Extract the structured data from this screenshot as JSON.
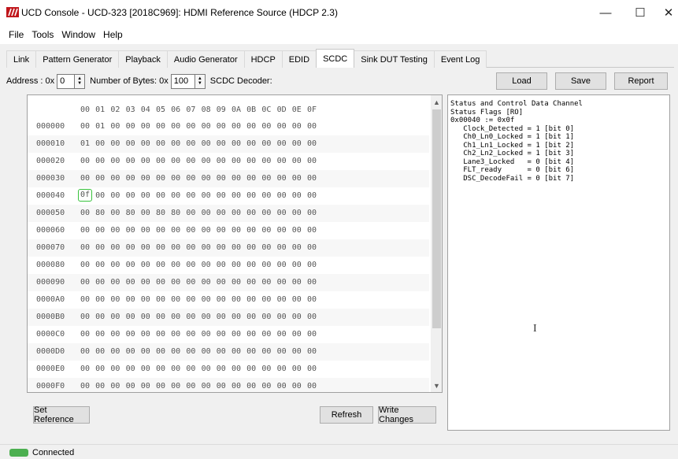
{
  "window": {
    "title": "UCD Console - UCD-323 [2018C969]: HDMI Reference Source (HDCP 2.3)",
    "minimize": "—",
    "maximize": "☐",
    "close": "✕"
  },
  "menu": [
    "File",
    "Tools",
    "Window",
    "Help"
  ],
  "tabs": [
    {
      "label": "Link"
    },
    {
      "label": "Pattern Generator"
    },
    {
      "label": "Playback"
    },
    {
      "label": "Audio Generator"
    },
    {
      "label": "HDCP"
    },
    {
      "label": "EDID"
    },
    {
      "label": "SCDC",
      "active": true
    },
    {
      "label": "Sink DUT Testing"
    },
    {
      "label": "Event Log"
    }
  ],
  "toolbar": {
    "address_label": "Address : 0x",
    "address_value": "0",
    "bytes_label": "Number of Bytes: 0x",
    "bytes_value": "100",
    "decoder_label": "SCDC Decoder:",
    "load": "Load",
    "save": "Save",
    "report": "Report"
  },
  "hex": {
    "columns": [
      "00",
      "01",
      "02",
      "03",
      "04",
      "05",
      "06",
      "07",
      "08",
      "09",
      "0A",
      "0B",
      "0C",
      "0D",
      "0E",
      "0F"
    ],
    "selected": {
      "row": 4,
      "col": 0
    },
    "rows": [
      {
        "addr": "000000",
        "bytes": [
          "00",
          "01",
          "00",
          "00",
          "00",
          "00",
          "00",
          "00",
          "00",
          "00",
          "00",
          "00",
          "00",
          "00",
          "00",
          "00"
        ]
      },
      {
        "addr": "000010",
        "bytes": [
          "01",
          "00",
          "00",
          "00",
          "00",
          "00",
          "00",
          "00",
          "00",
          "00",
          "00",
          "00",
          "00",
          "00",
          "00",
          "00"
        ]
      },
      {
        "addr": "000020",
        "bytes": [
          "00",
          "00",
          "00",
          "00",
          "00",
          "00",
          "00",
          "00",
          "00",
          "00",
          "00",
          "00",
          "00",
          "00",
          "00",
          "00"
        ]
      },
      {
        "addr": "000030",
        "bytes": [
          "00",
          "00",
          "00",
          "00",
          "00",
          "00",
          "00",
          "00",
          "00",
          "00",
          "00",
          "00",
          "00",
          "00",
          "00",
          "00"
        ]
      },
      {
        "addr": "000040",
        "bytes": [
          "0f",
          "00",
          "00",
          "00",
          "00",
          "00",
          "00",
          "00",
          "00",
          "00",
          "00",
          "00",
          "00",
          "00",
          "00",
          "00"
        ]
      },
      {
        "addr": "000050",
        "bytes": [
          "00",
          "80",
          "00",
          "80",
          "00",
          "80",
          "80",
          "00",
          "00",
          "00",
          "00",
          "00",
          "00",
          "00",
          "00",
          "00"
        ]
      },
      {
        "addr": "000060",
        "bytes": [
          "00",
          "00",
          "00",
          "00",
          "00",
          "00",
          "00",
          "00",
          "00",
          "00",
          "00",
          "00",
          "00",
          "00",
          "00",
          "00"
        ]
      },
      {
        "addr": "000070",
        "bytes": [
          "00",
          "00",
          "00",
          "00",
          "00",
          "00",
          "00",
          "00",
          "00",
          "00",
          "00",
          "00",
          "00",
          "00",
          "00",
          "00"
        ]
      },
      {
        "addr": "000080",
        "bytes": [
          "00",
          "00",
          "00",
          "00",
          "00",
          "00",
          "00",
          "00",
          "00",
          "00",
          "00",
          "00",
          "00",
          "00",
          "00",
          "00"
        ]
      },
      {
        "addr": "000090",
        "bytes": [
          "00",
          "00",
          "00",
          "00",
          "00",
          "00",
          "00",
          "00",
          "00",
          "00",
          "00",
          "00",
          "00",
          "00",
          "00",
          "00"
        ]
      },
      {
        "addr": "0000A0",
        "bytes": [
          "00",
          "00",
          "00",
          "00",
          "00",
          "00",
          "00",
          "00",
          "00",
          "00",
          "00",
          "00",
          "00",
          "00",
          "00",
          "00"
        ]
      },
      {
        "addr": "0000B0",
        "bytes": [
          "00",
          "00",
          "00",
          "00",
          "00",
          "00",
          "00",
          "00",
          "00",
          "00",
          "00",
          "00",
          "00",
          "00",
          "00",
          "00"
        ]
      },
      {
        "addr": "0000C0",
        "bytes": [
          "00",
          "00",
          "00",
          "00",
          "00",
          "00",
          "00",
          "00",
          "00",
          "00",
          "00",
          "00",
          "00",
          "00",
          "00",
          "00"
        ]
      },
      {
        "addr": "0000D0",
        "bytes": [
          "00",
          "00",
          "00",
          "00",
          "00",
          "00",
          "00",
          "00",
          "00",
          "00",
          "00",
          "00",
          "00",
          "00",
          "00",
          "00"
        ]
      },
      {
        "addr": "0000E0",
        "bytes": [
          "00",
          "00",
          "00",
          "00",
          "00",
          "00",
          "00",
          "00",
          "00",
          "00",
          "00",
          "00",
          "00",
          "00",
          "00",
          "00"
        ]
      },
      {
        "addr": "0000F0",
        "bytes": [
          "00",
          "00",
          "00",
          "00",
          "00",
          "00",
          "00",
          "00",
          "00",
          "00",
          "00",
          "00",
          "00",
          "00",
          "00",
          "00"
        ]
      }
    ]
  },
  "buttons": {
    "set_reference": "Set Reference",
    "refresh": "Refresh",
    "write_changes": "Write Changes"
  },
  "decoder": {
    "lines": [
      "Status and Control Data Channel",
      "Status Flags [RO]",
      "0x00040 := 0x0f",
      "   Clock_Detected = 1 [bit 0]",
      "   Ch0_Ln0_Locked = 1 [bit 1]",
      "   Ch1_Ln1_Locked = 1 [bit 2]",
      "   Ch2_Ln2_Locked = 1 [bit 3]",
      "   Lane3_Locked   = 0 [bit 4]",
      "   FLT_ready      = 0 [bit 6]",
      "   DSC_DecodeFail = 0 [bit 7]"
    ]
  },
  "status": {
    "connection": "Connected",
    "led_color": "#4caf50"
  },
  "colors": {
    "accent_logo": "#c0161b",
    "selected_outline": "#38c23c"
  }
}
